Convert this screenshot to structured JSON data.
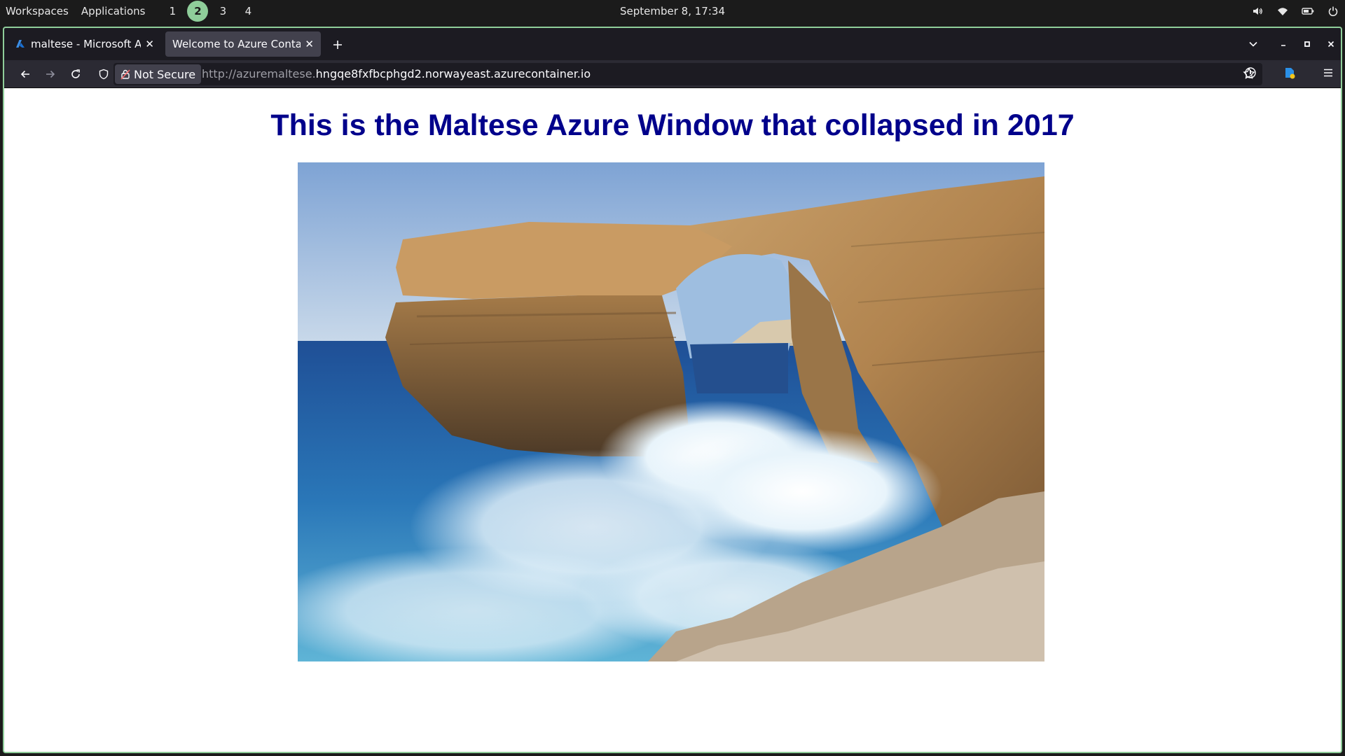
{
  "desktop": {
    "workspaces_label": "Workspaces",
    "applications_label": "Applications",
    "workspaces": [
      "1",
      "2",
      "3",
      "4"
    ],
    "active_workspace": "2",
    "clock": "September 8, 17:34"
  },
  "browser": {
    "tabs": [
      {
        "title": "maltese - Microsoft Azure",
        "favicon": "azure-icon",
        "active": false
      },
      {
        "title": "Welcome to Azure Container Instances",
        "active": true
      }
    ],
    "security_label": "Not Secure",
    "url_prefix": "http://azuremaltese.",
    "url_domain": "hngqe8fxfbcphgd2.norwayeast.azurecontainer.io",
    "accent_color": "#8fce9a"
  },
  "page": {
    "headline": "This is the Maltese Azure Window that collapsed in 2017",
    "headline_color": "#00008b"
  }
}
